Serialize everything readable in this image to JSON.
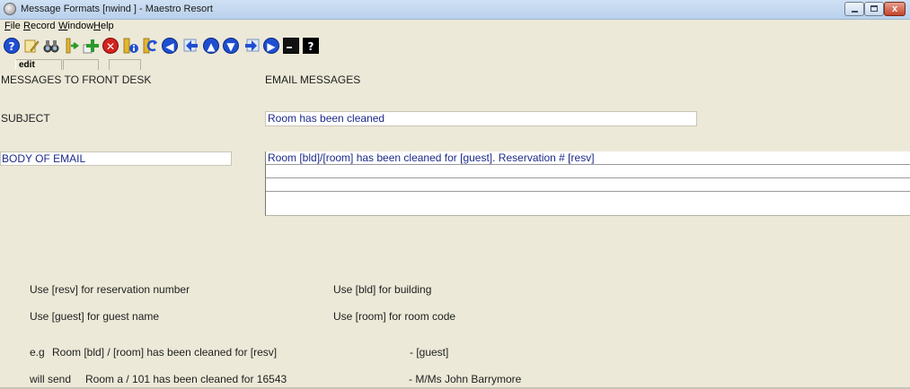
{
  "window": {
    "title": "Message Formats [nwind  ] - Maestro Resort",
    "controls": {
      "minimize": "minimize",
      "maximize": "maximize",
      "close": "x"
    }
  },
  "menu": [
    "File",
    "Record",
    "Window",
    "Help"
  ],
  "toolbar": {
    "icons": [
      "help-icon",
      "edit-pencil-icon",
      "find-binoculars-icon",
      "exit-door-icon",
      "add-record-icon",
      "delete-record-icon",
      "info-icon",
      "refresh-icon",
      "first-record-icon",
      "previous-record-icon",
      "up-icon",
      "down-icon",
      "next-record-icon",
      "last-record-icon",
      "console-icon",
      "context-help-icon"
    ],
    "colors": {
      "blue": "#1f4fd1",
      "red": "#d2231f",
      "green": "#2c9a2c",
      "yellow": "#e3b62a"
    }
  },
  "status": {
    "mode": "edit"
  },
  "form": {
    "front_desk_header": "MESSAGES TO FRONT DESK",
    "email_header": "EMAIL MESSAGES",
    "subject_label": "SUBJECT",
    "subject_value": "Room has been cleaned",
    "body_label": "BODY OF EMAIL",
    "body_lines": [
      "Room [bld]/[room] has been cleaned for [guest]. Reservation # [resv]",
      "",
      "",
      ""
    ]
  },
  "help": {
    "resv": "Use [resv] for reservation number",
    "bld": "Use [bld] for building",
    "guest": "Use [guest] for guest name",
    "room": "Use [room] for room code",
    "example_prefix": "e.g",
    "example_text": "Room [bld] / [room] has been cleaned for [resv]",
    "example_suffix": "- [guest]",
    "send_prefix": "will send",
    "send_text": "Room a / 101 has been cleaned for 16543",
    "send_suffix": "- M/Ms John Barrymore"
  },
  "colors": {
    "background": "#ece9d8",
    "field_text": "#1c2a8a"
  }
}
